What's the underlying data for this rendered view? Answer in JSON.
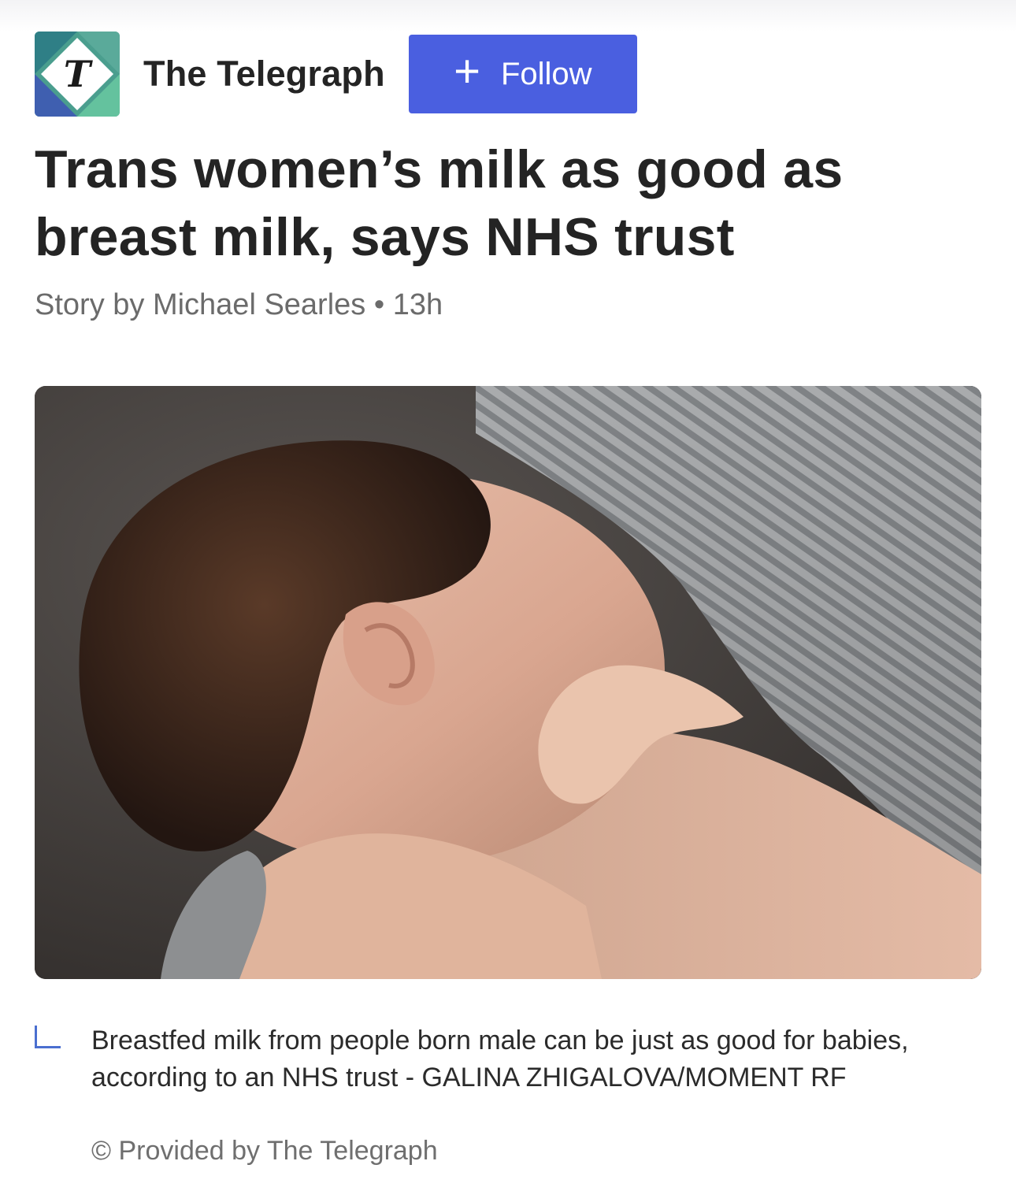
{
  "source": {
    "name": "The Telegraph",
    "logo_letter": "T",
    "follow_label": "Follow",
    "follow_icon": "plus-icon"
  },
  "article": {
    "headline": "Trans women’s milk as good as breast milk, says NHS trust",
    "byline": "Story by Michael Searles • 13h"
  },
  "image": {
    "alt_icon": "photo-baby-breastfeeding"
  },
  "caption": {
    "text": "Breastfed milk from people born male can be just as good for babies, according to an NHS trust - GALINA ZHIGALOVA/MOMENT RF",
    "credit": "© Provided by The Telegraph"
  },
  "colors": {
    "accent": "#4a5fe0",
    "caption_mark": "#4a6fd0",
    "logo_teal": "#5fb39a",
    "logo_blue": "#3f5fb0"
  }
}
